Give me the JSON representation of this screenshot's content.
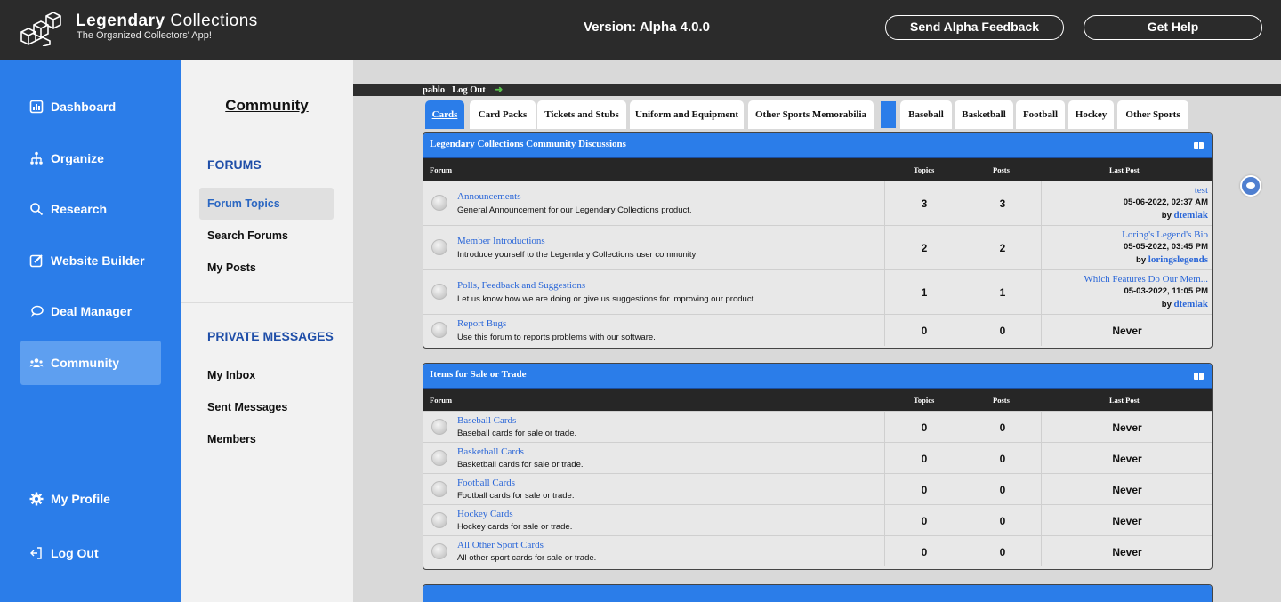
{
  "header": {
    "brand_bold": "Legendary",
    "brand_rest": "Collections",
    "tagline": "The Organized Collectors' App!",
    "version": "Version: Alpha 4.0.0",
    "feedback_button": "Send Alpha Feedback",
    "help_button": "Get Help"
  },
  "sidebar": {
    "items": [
      {
        "label": "Dashboard",
        "icon": "dashboard-icon"
      },
      {
        "label": "Organize",
        "icon": "organize-icon"
      },
      {
        "label": "Research",
        "icon": "search-icon"
      },
      {
        "label": "Website Builder",
        "icon": "edit-icon"
      },
      {
        "label": "Deal Manager",
        "icon": "chat-icon"
      },
      {
        "label": "Community",
        "icon": "people-icon",
        "active": true
      }
    ],
    "profile": "My Profile",
    "logout": "Log Out"
  },
  "subnav": {
    "title": "Community",
    "forums_heading": "FORUMS",
    "forum_links": [
      "Forum Topics",
      "Search Forums",
      "My Posts"
    ],
    "pm_heading": "PRIVATE MESSAGES",
    "pm_links": [
      "My Inbox",
      "Sent Messages",
      "Members"
    ]
  },
  "userbar": {
    "username": "pablo",
    "logout": "Log Out"
  },
  "tabs": [
    "Cards",
    "Card Packs",
    "Tickets and Stubs",
    "Uniform and Equipment",
    "Other Sports Memorabilia",
    "Baseball",
    "Basketball",
    "Football",
    "Hockey",
    "Other Sports"
  ],
  "columns": {
    "forum": "Forum",
    "topics": "Topics",
    "posts": "Posts",
    "last_post": "Last Post"
  },
  "sections": [
    {
      "title": "Legendary Collections Community Discussions",
      "forums": [
        {
          "name": "Announcements",
          "desc": "General Announcement for our Legendary Collections product.",
          "topics": "3",
          "posts": "3",
          "last_title": "test",
          "last_date": "05-06-2022, 02:37 AM",
          "by": "by",
          "last_user": "dtemlak"
        },
        {
          "name": "Member Introductions",
          "desc": "Introduce yourself to the Legendary Collections user community!",
          "topics": "2",
          "posts": "2",
          "last_title": "Loring's Legend's Bio",
          "last_date": "05-05-2022, 03:45 PM",
          "by": "by",
          "last_user": "loringslegends"
        },
        {
          "name": "Polls, Feedback and Suggestions",
          "desc": "Let us know how we are doing or give us suggestions for improving our product.",
          "topics": "1",
          "posts": "1",
          "last_title": "Which Features Do Our Mem...",
          "last_date": "05-03-2022, 11:05 PM",
          "by": "by",
          "last_user": "dtemlak"
        },
        {
          "name": "Report Bugs",
          "desc": "Use this forum to reports problems with our software.",
          "topics": "0",
          "posts": "0",
          "last_never": "Never"
        }
      ]
    },
    {
      "title": "Items for Sale or Trade",
      "forums": [
        {
          "name": "Baseball Cards",
          "desc": "Baseball cards for sale or trade.",
          "topics": "0",
          "posts": "0",
          "last_never": "Never"
        },
        {
          "name": "Basketball Cards",
          "desc": "Basketball cards for sale or trade.",
          "topics": "0",
          "posts": "0",
          "last_never": "Never"
        },
        {
          "name": "Football Cards",
          "desc": "Football cards for sale or trade.",
          "topics": "0",
          "posts": "0",
          "last_never": "Never"
        },
        {
          "name": "Hockey Cards",
          "desc": "Hockey cards for sale or trade.",
          "topics": "0",
          "posts": "0",
          "last_never": "Never"
        },
        {
          "name": "All Other Sport Cards",
          "desc": "All other sport cards for sale or trade.",
          "topics": "0",
          "posts": "0",
          "last_never": "Never"
        }
      ]
    }
  ],
  "colors": {
    "brand_blue": "#2b7de9",
    "topbar": "#2b2b2b",
    "link": "#2b67d8"
  }
}
